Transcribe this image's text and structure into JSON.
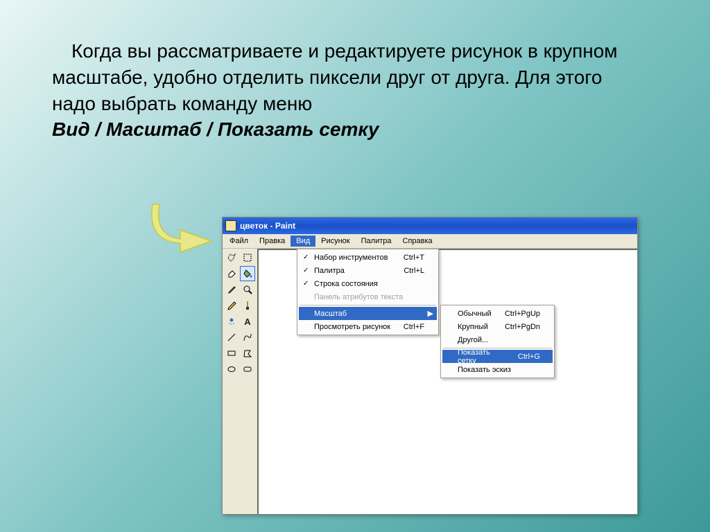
{
  "slide": {
    "paragraph": "Когда вы рассматриваете и редактируете рисунок в крупном масштабе, удобно отделить пиксели друг от друга. Для этого надо выбрать команду меню",
    "command": "Вид / Масштаб / Показать сетку"
  },
  "window": {
    "title": "цветок - Paint"
  },
  "menubar": {
    "items": [
      "Файл",
      "Правка",
      "Вид",
      "Рисунок",
      "Палитра",
      "Справка"
    ]
  },
  "dropdown1": {
    "toolbox": {
      "label": "Набор инструментов",
      "shortcut": "Ctrl+T"
    },
    "palette": {
      "label": "Палитра",
      "shortcut": "Ctrl+L"
    },
    "statusbar": {
      "label": "Строка состояния",
      "shortcut": ""
    },
    "textattr": {
      "label": "Панель атрибутов текста",
      "shortcut": ""
    },
    "zoom": {
      "label": "Масштаб",
      "shortcut": ""
    },
    "view": {
      "label": "Просмотреть рисунок",
      "shortcut": "Ctrl+F"
    }
  },
  "dropdown2": {
    "normal": {
      "label": "Обычный",
      "shortcut": "Ctrl+PgUp"
    },
    "large": {
      "label": "Крупный",
      "shortcut": "Ctrl+PgDn"
    },
    "other": {
      "label": "Другой...",
      "shortcut": ""
    },
    "grid": {
      "label": "Показать сетку",
      "shortcut": "Ctrl+G"
    },
    "thumb": {
      "label": "Показать эскиз",
      "shortcut": ""
    }
  }
}
